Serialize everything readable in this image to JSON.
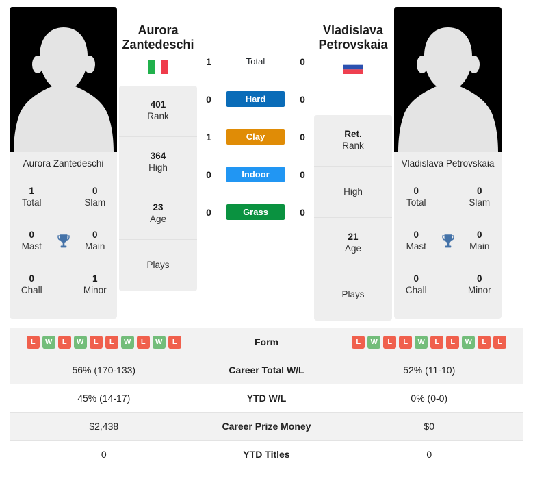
{
  "players": {
    "left": {
      "first_name": "Aurora",
      "last_name": "Zantedeschi",
      "full_name": "Aurora Zantedeschi",
      "country_flag": "italy-flag",
      "rank": "401",
      "rank_label": "Rank",
      "high": "364",
      "high_label": "High",
      "age": "23",
      "age_label": "Age",
      "plays": "",
      "plays_label": "Plays",
      "titles": {
        "total": "1",
        "total_label": "Total",
        "slam": "0",
        "slam_label": "Slam",
        "mast": "0",
        "mast_label": "Mast",
        "main": "0",
        "main_label": "Main",
        "chall": "0",
        "chall_label": "Chall",
        "minor": "1",
        "minor_label": "Minor"
      },
      "form": [
        "L",
        "W",
        "L",
        "W",
        "L",
        "L",
        "W",
        "L",
        "W",
        "L"
      ],
      "career_total_wl": "56% (170-133)",
      "ytd_wl": "45% (14-17)",
      "career_prize_money": "$2,438",
      "ytd_titles": "0"
    },
    "right": {
      "first_name": "Vladislava",
      "last_name": "Petrovskaia",
      "full_name": "Vladislava Petrovskaia",
      "country_flag": "russia-flag",
      "rank": "Ret.",
      "rank_label": "Rank",
      "high": "",
      "high_label": "High",
      "age": "21",
      "age_label": "Age",
      "plays": "",
      "plays_label": "Plays",
      "titles": {
        "total": "0",
        "total_label": "Total",
        "slam": "0",
        "slam_label": "Slam",
        "mast": "0",
        "mast_label": "Mast",
        "main": "0",
        "main_label": "Main",
        "chall": "0",
        "chall_label": "Chall",
        "minor": "0",
        "minor_label": "Minor"
      },
      "form": [
        "L",
        "W",
        "L",
        "L",
        "W",
        "L",
        "L",
        "W",
        "L",
        "L"
      ],
      "career_total_wl": "52% (11-10)",
      "ytd_wl": "0% (0-0)",
      "career_prize_money": "$0",
      "ytd_titles": "0"
    }
  },
  "h2h": [
    {
      "label": "Total",
      "left": "1",
      "right": "0",
      "color": "",
      "plain": true
    },
    {
      "label": "Hard",
      "left": "0",
      "right": "0",
      "color": "#0a6cb8",
      "plain": false
    },
    {
      "label": "Clay",
      "left": "1",
      "right": "0",
      "color": "#e08c06",
      "plain": false
    },
    {
      "label": "Indoor",
      "left": "0",
      "right": "0",
      "color": "#2196f3",
      "plain": false
    },
    {
      "label": "Grass",
      "left": "0",
      "right": "0",
      "color": "#0a9240",
      "plain": false
    }
  ],
  "table": {
    "rows": [
      {
        "label": "Form",
        "type": "form"
      },
      {
        "label": "Career Total W/L",
        "type": "text",
        "key": "career_total_wl"
      },
      {
        "label": "YTD W/L",
        "type": "text",
        "key": "ytd_wl"
      },
      {
        "label": "Career Prize Money",
        "type": "text",
        "key": "career_prize_money"
      },
      {
        "label": "YTD Titles",
        "type": "text",
        "key": "ytd_titles"
      }
    ]
  },
  "colors": {
    "win": "#73bd7a",
    "loss": "#f0604d",
    "trophy": "#4472a8",
    "panel_bg": "#eeeeee",
    "row_shade": "#f2f2f2"
  }
}
